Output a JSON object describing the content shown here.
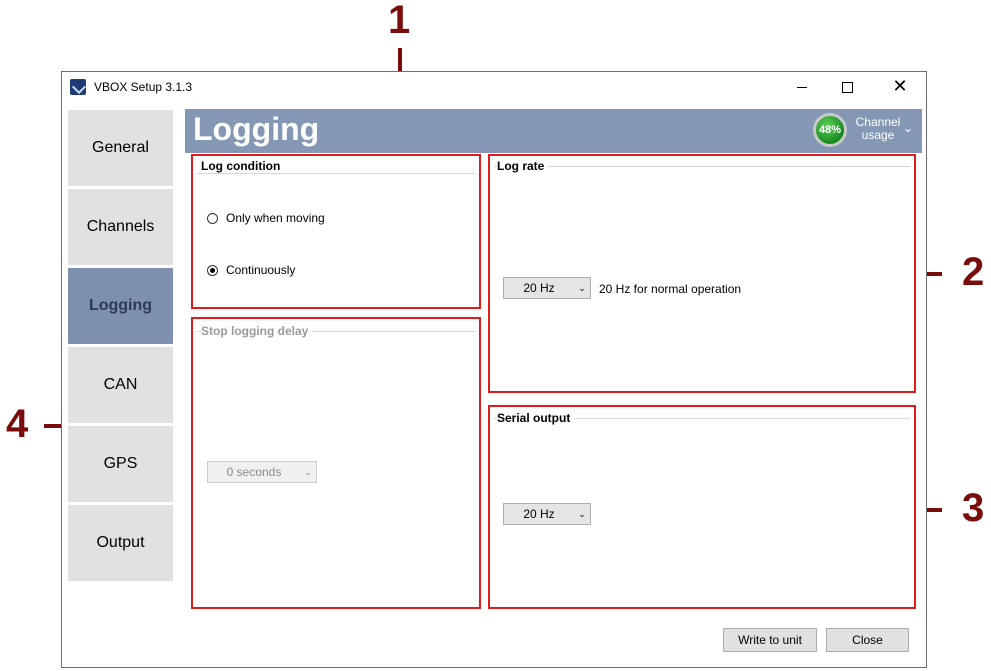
{
  "window": {
    "title": "VBOX Setup 3.1.3",
    "minimize_glyph": "—",
    "maximize_glyph": "☐",
    "close_glyph": "✕"
  },
  "nav": {
    "items": [
      {
        "label": "General"
      },
      {
        "label": "Channels"
      },
      {
        "label": "Logging"
      },
      {
        "label": "CAN"
      },
      {
        "label": "GPS"
      },
      {
        "label": "Output"
      }
    ],
    "active": "Logging"
  },
  "header": {
    "title": "Logging",
    "usage_percent": "48%",
    "usage_label_line1": "Channel",
    "usage_label_line2": "usage",
    "accent_color": "#8497b4"
  },
  "log_condition": {
    "title": "Log condition",
    "options": [
      {
        "label": "Only when moving",
        "selected": false
      },
      {
        "label": "Continuously",
        "selected": true
      }
    ]
  },
  "stop_logging_delay": {
    "title": "Stop logging delay",
    "value": "0 seconds",
    "enabled": false
  },
  "log_rate": {
    "title": "Log rate",
    "value": "20 Hz",
    "note": "20 Hz for normal operation"
  },
  "serial_output": {
    "title": "Serial output",
    "value": "20 Hz"
  },
  "footer": {
    "write_label": "Write to unit",
    "close_label": "Close"
  },
  "annotations": {
    "one": "1",
    "two": "2",
    "three": "3",
    "four": "4",
    "color": "#7a0c0c",
    "highlight_color": "#e01b1b"
  }
}
